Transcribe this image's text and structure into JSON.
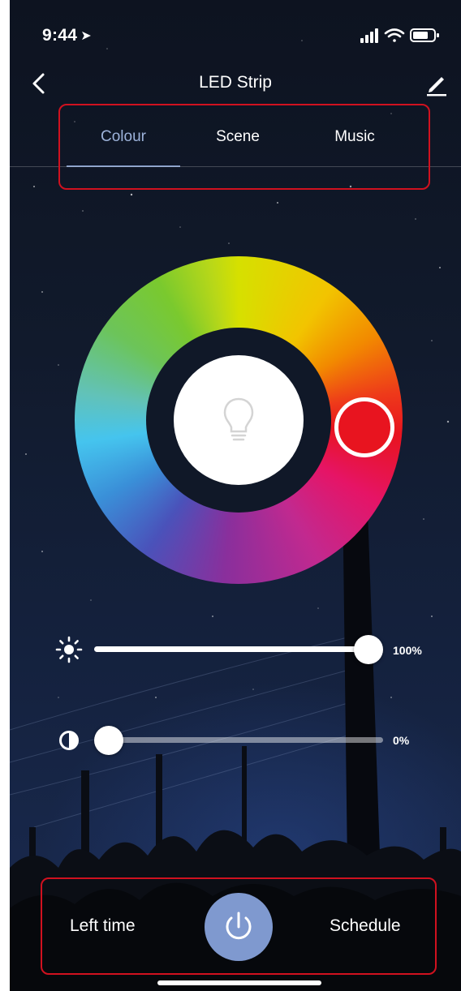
{
  "status_bar": {
    "time": "9:44",
    "location_icon": "location-arrow-icon"
  },
  "nav": {
    "title": "LED Strip",
    "back_icon": "chevron-left-icon",
    "edit_icon": "pencil-icon"
  },
  "tabs": [
    {
      "label": "Colour",
      "active": true
    },
    {
      "label": "Scene",
      "active": false
    },
    {
      "label": "Music",
      "active": false
    }
  ],
  "colour_wheel": {
    "selected_color": "#e8141f",
    "center_icon": "lightbulb-icon"
  },
  "sliders": {
    "brightness": {
      "icon": "sun-icon",
      "value": 100,
      "label": "100%"
    },
    "contrast": {
      "icon": "contrast-icon",
      "value": 0,
      "label": "0%"
    }
  },
  "bottom": {
    "left_label": "Left time",
    "power_icon": "power-icon",
    "right_label": "Schedule"
  },
  "colors": {
    "accent": "#7f99cf",
    "tab_active": "#9db3da",
    "highlight_box": "#d0111f"
  }
}
